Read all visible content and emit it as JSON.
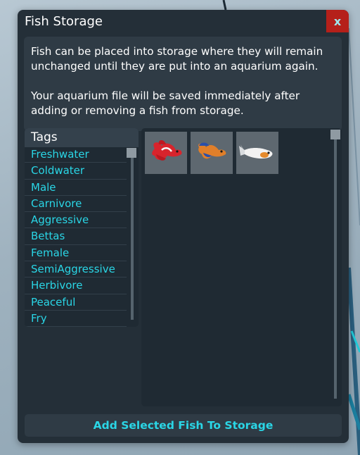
{
  "dialog": {
    "title": "Fish Storage",
    "close_label": "x"
  },
  "info": {
    "paragraph1": "Fish can be placed into storage where they will remain unchanged until they are put into an aquarium again.",
    "paragraph2": "Your aquarium file will be saved immediately after adding or removing a fish from storage."
  },
  "tags": {
    "header": "Tags",
    "items": [
      {
        "label": "Freshwater"
      },
      {
        "label": "Coldwater"
      },
      {
        "label": "Male"
      },
      {
        "label": "Carnivore"
      },
      {
        "label": "Aggressive"
      },
      {
        "label": "Bettas"
      },
      {
        "label": "Female"
      },
      {
        "label": "SemiAggressive"
      },
      {
        "label": "Herbivore"
      },
      {
        "label": "Peaceful"
      },
      {
        "label": "Fry"
      }
    ]
  },
  "fish": [
    {
      "icon": "red-betta-fish-icon",
      "color": "#d8242c"
    },
    {
      "icon": "blue-orange-betta-fish-icon",
      "color": "#e07f2a"
    },
    {
      "icon": "white-orange-fish-icon",
      "color": "#f2f2f2"
    }
  ],
  "actions": {
    "add_label": "Add Selected Fish To Storage"
  },
  "colors": {
    "accent": "#2ad6e6",
    "close_bg": "#b5201a",
    "panel": "#242f38"
  }
}
